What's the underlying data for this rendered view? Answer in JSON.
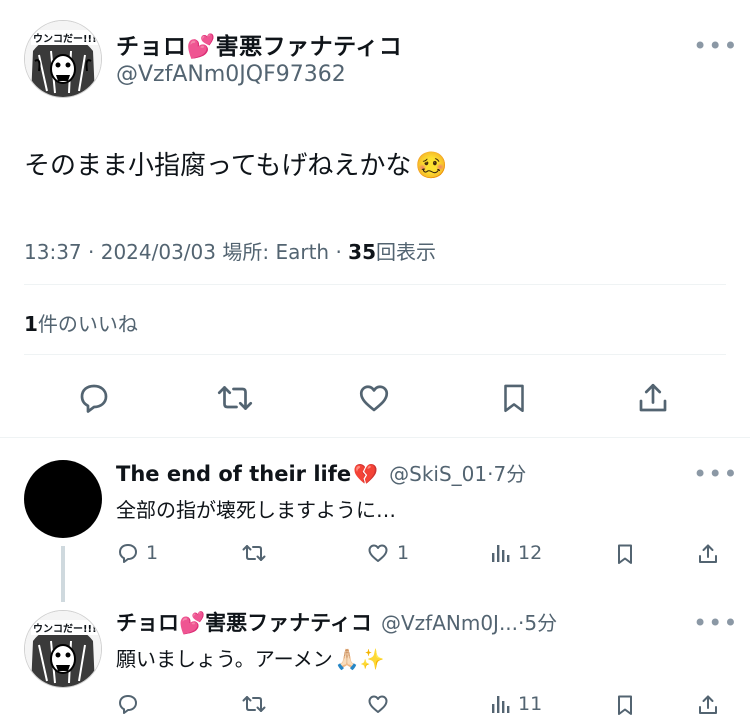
{
  "main_tweet": {
    "author_name": "チョロ💕害悪ファナティコ",
    "author_handle": "@VzfANm0JQF97362",
    "avatar_text": "ウンコだー!!!",
    "text": "そのまま小指腐ってもげねえかな",
    "text_emoji": "🥴",
    "time": "13:37",
    "date": "2024/03/03",
    "location": "場所: Earth",
    "views_count": "35",
    "views_label": "回表示",
    "likes_count": "1",
    "likes_label": "件のいいね"
  },
  "replies": [
    {
      "author_name": "The end of their life",
      "name_emoji": "💔",
      "author_handle": "@SkiS_01",
      "time_ago": "7分",
      "text": "全部の指が壊死しますように…",
      "reply_count": "1",
      "retweet_count": "",
      "like_count": "1",
      "view_count": "12"
    },
    {
      "author_name": "チョロ💕害悪ファナティコ",
      "author_handle": "@VzfANm0J...",
      "time_ago": "5分",
      "text": "願いましょう。アーメン",
      "text_emoji": "🙏🏻✨",
      "avatar_text": "ウンコだー!!!",
      "reply_count": "",
      "retweet_count": "",
      "like_count": "",
      "view_count": "11"
    }
  ],
  "separator": "·",
  "more_label": "•••",
  "colors": {
    "text": "#0f1419",
    "secondary": "#536471",
    "divider": "#eff3f4",
    "icon": "#536471"
  },
  "icons": [
    "reply-icon",
    "retweet-icon",
    "like-icon",
    "bookmark-icon",
    "share-icon",
    "views-icon",
    "more-icon"
  ]
}
